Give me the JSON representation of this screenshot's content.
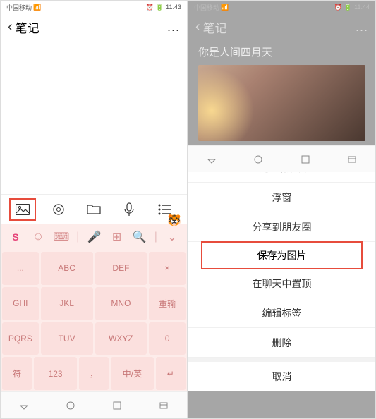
{
  "left": {
    "status": {
      "carrier": "中国移动",
      "time": "11:43"
    },
    "header": {
      "title": "笔记",
      "more": "..."
    },
    "keyboard": {
      "rows": [
        [
          "...",
          "ABC",
          "DEF",
          "×"
        ],
        [
          "GHI",
          "JKL",
          "MNO",
          "重输"
        ],
        [
          "PQRS",
          "TUV",
          "WXYZ",
          "0"
        ],
        [
          "符",
          "123",
          "，",
          "中/英",
          "↵"
        ]
      ]
    }
  },
  "right": {
    "status": {
      "carrier": "中国移动",
      "time": "11:44"
    },
    "header": {
      "title": "笔记",
      "more": "..."
    },
    "note": {
      "title": "你是人间四月天"
    },
    "sheet": {
      "items": [
        "发送给朋友",
        "浮窗",
        "分享到朋友圈",
        "保存为图片",
        "在聊天中置顶",
        "编辑标签",
        "删除"
      ],
      "cancel": "取消",
      "highlighted_index": 3
    }
  }
}
